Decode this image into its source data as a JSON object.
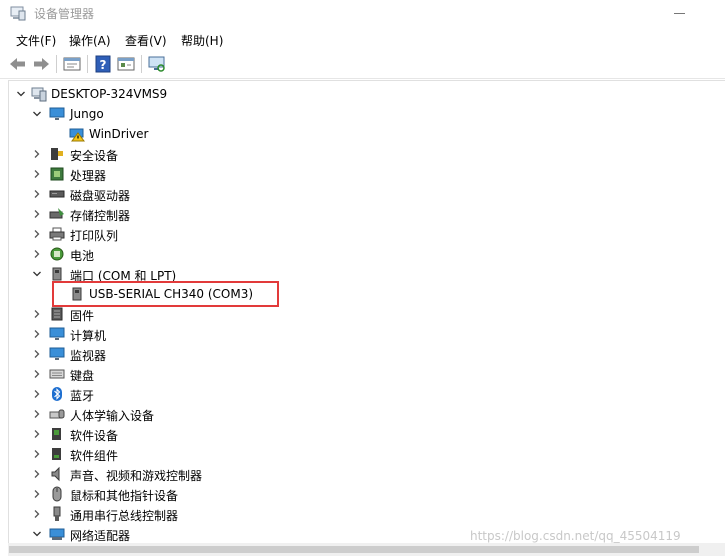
{
  "window": {
    "title": "设备管理器"
  },
  "menu": [
    {
      "label": "文件(F)"
    },
    {
      "label": "操作(A)"
    },
    {
      "label": "查看(V)"
    },
    {
      "label": "帮助(H)"
    }
  ],
  "toolbar_icons": [
    "back-arrow-icon",
    "forward-arrow-icon",
    "properties-icon",
    "help-icon",
    "view-icon",
    "scan-hardware-icon"
  ],
  "tree": {
    "root": {
      "label": "DESKTOP-324VMS9",
      "icon": "computer-icon"
    },
    "items": [
      {
        "label": "Jungo",
        "icon": "monitor-icon",
        "expanded": true,
        "level": 1
      },
      {
        "label": "WinDriver",
        "icon": "warning-driver-icon",
        "level": 2
      },
      {
        "label": "安全设备",
        "icon": "security-device-icon",
        "level": 1
      },
      {
        "label": "处理器",
        "icon": "processor-icon",
        "level": 1
      },
      {
        "label": "磁盘驱动器",
        "icon": "disk-drive-icon",
        "level": 1
      },
      {
        "label": "存储控制器",
        "icon": "storage-controller-icon",
        "level": 1
      },
      {
        "label": "打印队列",
        "icon": "printer-icon",
        "level": 1
      },
      {
        "label": "电池",
        "icon": "battery-icon",
        "level": 1
      },
      {
        "label": "端口 (COM 和 LPT)",
        "icon": "port-icon",
        "expanded": true,
        "level": 1
      },
      {
        "label": "USB-SERIAL CH340 (COM3)",
        "icon": "port-icon",
        "level": 2
      },
      {
        "label": "固件",
        "icon": "firmware-icon",
        "level": 1
      },
      {
        "label": "计算机",
        "icon": "monitor-icon",
        "level": 1
      },
      {
        "label": "监视器",
        "icon": "monitor-icon",
        "level": 1
      },
      {
        "label": "键盘",
        "icon": "keyboard-icon",
        "level": 1
      },
      {
        "label": "蓝牙",
        "icon": "bluetooth-icon",
        "level": 1
      },
      {
        "label": "人体学输入设备",
        "icon": "hid-icon",
        "level": 1
      },
      {
        "label": "软件设备",
        "icon": "software-device-icon",
        "level": 1
      },
      {
        "label": "软件组件",
        "icon": "software-component-icon",
        "level": 1
      },
      {
        "label": "声音、视频和游戏控制器",
        "icon": "speaker-icon",
        "level": 1
      },
      {
        "label": "鼠标和其他指针设备",
        "icon": "mouse-icon",
        "level": 1
      },
      {
        "label": "通用串行总线控制器",
        "icon": "usb-icon",
        "level": 1
      },
      {
        "label": "网络适配器",
        "icon": "network-adapter-icon",
        "level": 1
      }
    ]
  },
  "watermark": "https://blog.csdn.net/qq_45504119",
  "colors": {
    "highlight": "#e23a3a"
  }
}
